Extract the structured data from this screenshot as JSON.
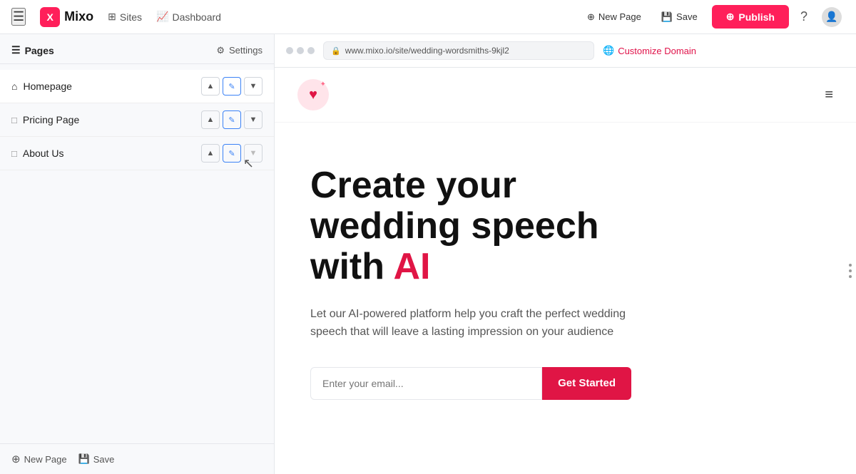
{
  "nav": {
    "hamburger": "☰",
    "logo_letter": "X",
    "logo_text": "Mixo",
    "sites_label": "Sites",
    "dashboard_label": "Dashboard",
    "new_page_label": "New Page",
    "save_label": "Save",
    "publish_label": "Publish",
    "help_icon": "?",
    "chart_icon": "📈"
  },
  "sidebar": {
    "pages_label": "Pages",
    "settings_label": "Settings",
    "pages": [
      {
        "id": "homepage",
        "label": "Homepage",
        "icon": "⌂",
        "expanded": true
      },
      {
        "id": "pricing",
        "label": "Pricing Page",
        "icon": "□",
        "expanded": true
      },
      {
        "id": "about",
        "label": "About Us",
        "icon": "□",
        "expanded": false
      }
    ],
    "new_page_label": "New Page",
    "save_label": "Save"
  },
  "browser": {
    "url": "www.mixo.io/site/wedding-wordsmiths-9kjl2",
    "customize_domain_label": "Customize Domain"
  },
  "preview": {
    "hero_heading_line1": "Create your",
    "hero_heading_line2": "wedding speech",
    "hero_heading_line3": "with ",
    "hero_heading_ai": "AI",
    "hero_sub": "Let our AI-powered platform help you craft the perfect wedding speech that will leave a lasting impression on your audience",
    "email_placeholder": "Enter your email...",
    "cta_label": "Get Started"
  },
  "colors": {
    "brand_red": "#ff1f5a",
    "hero_ai_red": "#e01545",
    "cta_red": "#e01545"
  }
}
